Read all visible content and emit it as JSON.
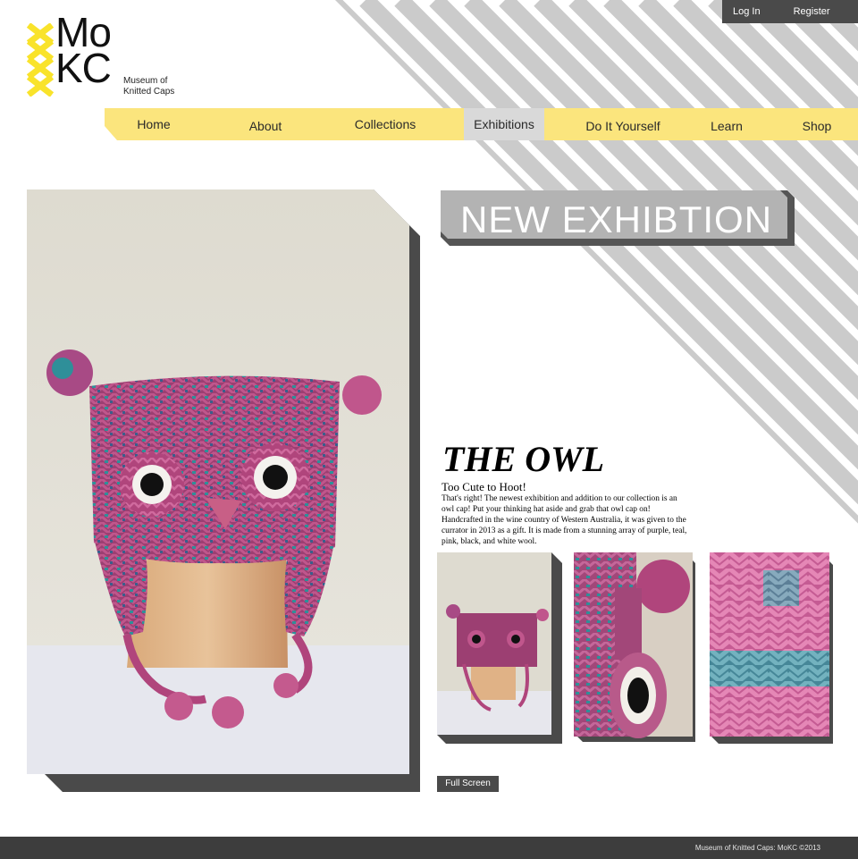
{
  "account": {
    "login_label": "Log In",
    "register_label": "Register"
  },
  "logo": {
    "line1": "Mo",
    "line2": "KC",
    "sub1": "Museum of",
    "sub2": "Knitted Caps"
  },
  "nav": {
    "items": [
      {
        "label": "Home"
      },
      {
        "label": "About"
      },
      {
        "label": "Collections"
      },
      {
        "label": "Exhibitions"
      },
      {
        "label": "Do It Yourself"
      },
      {
        "label": "Learn"
      },
      {
        "label": "Shop"
      }
    ],
    "active": "Exhibitions"
  },
  "exhibition": {
    "banner": "NEW EXHIBTION",
    "title": "THE OWL",
    "subtitle": "Too Cute to Hoot!",
    "description": "That's right! The newest exhibition and addition to our collection is an owl cap! Put your thinking hat aside and grab that owl cap on! Handcrafted in the wine country of Western Australia, it was given to the currator in 2013 as a gift. It is made from a stunning array of purple, teal, pink, black, and white wool."
  },
  "full_screen_label": "Full Screen",
  "footer": {
    "text": "Museum of Knitted Caps: MoKC ©2013"
  },
  "colors": {
    "accent_yellow": "#fbe57d",
    "logo_yellow": "#f9e32b",
    "stripe_gray": "#cbcbcb",
    "dark_gray": "#4a4a4a",
    "banner_gray": "#b3b3b3",
    "yarn_pink": "#b0457c",
    "yarn_teal": "#2f8f99"
  },
  "icons": {
    "logo_mark": "yellow-x-stack"
  }
}
